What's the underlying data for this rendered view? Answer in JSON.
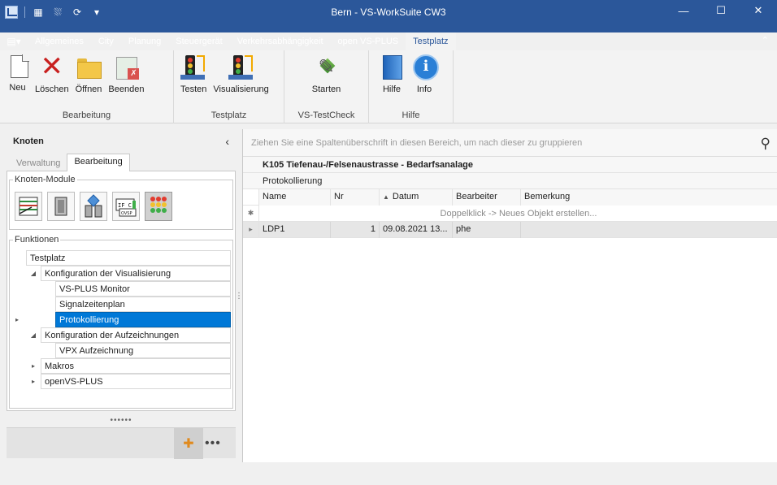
{
  "window": {
    "title": "Bern - VS-WorkSuite CW3",
    "minimize": "—",
    "maximize": "☐",
    "close": "✕"
  },
  "ribbon_tabs": [
    "Allgemeines",
    "City",
    "Planung",
    "Steuergerät",
    "Verkehrsabhängigkeit",
    "open VS-PLUS",
    "Testplatz"
  ],
  "active_tab": "Testplatz",
  "ribbon": {
    "groups": [
      {
        "name": "Bearbeitung",
        "buttons": [
          "Neu",
          "Löschen",
          "Öffnen",
          "Beenden"
        ]
      },
      {
        "name": "Testplatz",
        "buttons": [
          "Testen",
          "Visualisierung"
        ]
      },
      {
        "name": "VS-TestCheck",
        "buttons": [
          "Starten"
        ]
      },
      {
        "name": "Hilfe",
        "buttons": [
          "Hilfe",
          "Info"
        ]
      }
    ]
  },
  "left_pane": {
    "title": "Knoten",
    "tabs": [
      "Verwaltung",
      "Bearbeitung"
    ],
    "active_tab": "Bearbeitung",
    "modules_legend": "Knoten-Module",
    "functions_legend": "Funktionen",
    "tree": {
      "root": "Testplatz",
      "items": [
        {
          "label": "Konfiguration der Visualisierung",
          "children": [
            "VS-PLUS Monitor",
            "Signalzeitenplan",
            "Protokollierung"
          ]
        },
        {
          "label": "Konfiguration der Aufzeichnungen",
          "children": [
            "VPX Aufzeichnung"
          ]
        },
        {
          "label": "Makros",
          "children": []
        },
        {
          "label": "openVS-PLUS",
          "children": []
        }
      ],
      "selected": "Protokollierung"
    },
    "grip": "••••••",
    "more": "•••"
  },
  "right_pane": {
    "group_hint": "Ziehen Sie eine Spaltenüberschrift in diesen Bereich, um nach dieser zu gruppieren",
    "caption": "K105 Tiefenau-/Felsenaustrasse - Bedarfsanalage",
    "subcaption": "Protokollierung",
    "columns": [
      "Name",
      "Nr",
      "Datum",
      "Bearbeiter",
      "Bemerkung"
    ],
    "new_row_hint": "Doppelklick -> Neues Objekt erstellen...",
    "rows": [
      {
        "Name": "LDP1",
        "Nr": "1",
        "Datum": "09.08.2021 13...",
        "Bearbeiter": "phe",
        "Bemerkung": ""
      }
    ]
  },
  "colors": {
    "accent": "#2b579a",
    "selection": "#0078d7"
  }
}
